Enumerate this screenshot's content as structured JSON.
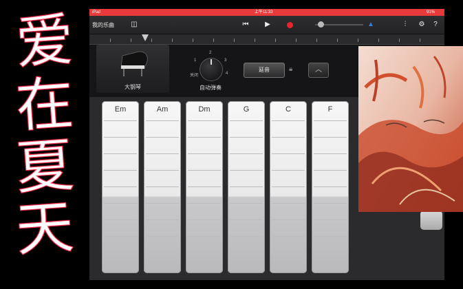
{
  "calligraphy": [
    "爱",
    "在",
    "夏",
    "天"
  ],
  "status": {
    "left": "iPad",
    "time": "上午11:33",
    "battery": "91%"
  },
  "toolbar": {
    "my_songs": "我的乐曲"
  },
  "instrument": {
    "name": "大钢琴"
  },
  "autoplay": {
    "label": "自动弹奏",
    "off": "关闭",
    "n1": "1",
    "n2": "2",
    "n3": "3",
    "n4": "4"
  },
  "sustain": {
    "label": "延音"
  },
  "chords": [
    "Em",
    "Am",
    "Dm",
    "G",
    "C",
    "F"
  ],
  "colors": {
    "status_bar": "#e83a3a",
    "record": "#e8242d",
    "accent_blue": "#3a7bd5"
  }
}
